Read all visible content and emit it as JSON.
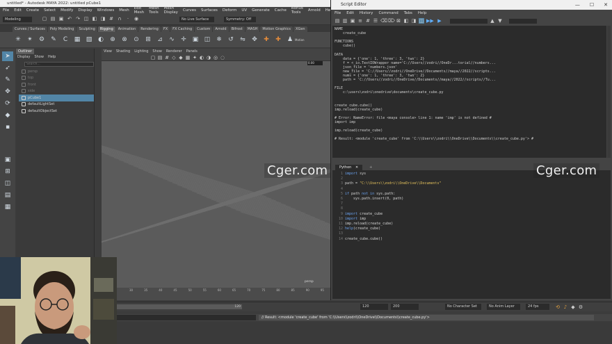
{
  "maya": {
    "title": "untitled* - Autodesk MAYA 2022: untitled    pCube1",
    "menus": [
      "File",
      "Edit",
      "Create",
      "Select",
      "Modify",
      "Display",
      "Windows",
      "Mesh",
      "Edit Mesh",
      "Mesh Tools",
      "Mesh Display",
      "Curves",
      "Surfaces",
      "Deform",
      "UV",
      "Generate",
      "Cache",
      "Bonus Tools",
      "Arnold",
      "Help"
    ],
    "workspace": "Modeling",
    "live_surface": "No Live Surface",
    "symmetry": "Symmetry: Off",
    "shelf_tabs": [
      "Curves / Surfaces",
      "Poly Modeling",
      "Sculpting",
      "Rigging",
      "Animation",
      "Rendering",
      "FX",
      "FX Caching",
      "Custom",
      "Arnold",
      "Bifrost",
      "MASH",
      "Motion Graphics",
      "XGen"
    ],
    "active_shelf": "Rigging",
    "shelf_label_motion": "Motion"
  },
  "outliner": {
    "tab": "Outliner",
    "menu": [
      "Display",
      "Show",
      "Help"
    ],
    "search_placeholder": "Search...",
    "items": [
      {
        "label": "persp",
        "selected": false,
        "visible": false
      },
      {
        "label": "top",
        "selected": false,
        "visible": false
      },
      {
        "label": "front",
        "selected": false,
        "visible": false
      },
      {
        "label": "side",
        "selected": false,
        "visible": false
      },
      {
        "label": "pCube1",
        "selected": true,
        "visible": true
      },
      {
        "label": "defaultLightSet",
        "selected": false,
        "visible": true
      },
      {
        "label": "defaultObjectSet",
        "selected": false,
        "visible": true
      }
    ]
  },
  "viewport": {
    "menus": [
      "View",
      "Shading",
      "Lighting",
      "Show",
      "Renderer",
      "Panels"
    ],
    "camera": "persp",
    "fps_value": "0.00"
  },
  "timeline": {
    "ticks": [
      "30",
      "35",
      "40",
      "45",
      "50",
      "55",
      "60",
      "65",
      "70",
      "75",
      "80",
      "85",
      "90",
      "95"
    ],
    "range_value": "120",
    "end_values": [
      "120",
      "200"
    ],
    "character_set": "No Character Set",
    "anim_layer": "No Anim Layer",
    "fps": "24 fps"
  },
  "command_line": {
    "result": "// Result: <module 'create_cube' from 'C:\\\\Users\\\\zodri\\\\OneDrive\\\\Documents\\\\create_cube.py'>"
  },
  "script_editor": {
    "title": "Script Editor",
    "menus": [
      "File",
      "Edit",
      "History",
      "Command",
      "Tabs",
      "Help"
    ],
    "history_lines": [
      "NAME",
      "    create_cube",
      "",
      "FUNCTIONS",
      "    cube()",
      "",
      "DATA",
      "    data = {'one': 1, 'three': 3, 'two': 2}",
      "    f = <_io.TextIOWrapper name='C://Users//zodri//OneDr...torial//numbers...",
      "    json_file = 'numbers.json'",
      "    new_file = 'C://Users//zodri//OneDrive//Documents//maya//2022//scripts...",
      "    nums = {'one': 1, 'three': 3, 'two': 2}",
      "    path = 'C://Users//zodri//OneDrive//Documents//maya//2022//scripts//Tu...",
      "",
      "FILE",
      "    c:\\users\\zodri\\onedrive\\documents\\create_cube.py",
      "",
      "",
      "create_cube.cube()",
      "imp.reload(create_cube)",
      "",
      "# Error: NameError: file <maya console> line 1: name 'imp' is not defined #",
      "import imp",
      "",
      "imp.reload(create_cube)",
      "",
      "# Result: <module 'create_cube' from 'C:\\\\Users\\\\zodri\\\\OneDrive\\\\Documents\\\\create_cube.py'> #"
    ],
    "tabs": [
      "Python"
    ],
    "add_tab": "+",
    "line_numbers": [
      "1",
      "2",
      "3",
      "4",
      "5",
      "6",
      "7",
      "8",
      "9",
      "10",
      "11",
      "12",
      "13",
      "14"
    ],
    "code": {
      "l1_kw": "import",
      "l1_rest": " sys",
      "l3_pre": "path = ",
      "l3_str": "\"C:\\\\Users\\\\zodri\\\\OneDrive\\\\Documents\"",
      "l5_kw1": "if",
      "l5_mid": " path ",
      "l5_kw2": "not in",
      "l5_rest": " sys.path:",
      "l6": "    sys.path.insert(0, path)",
      "l9_kw": "import",
      "l9_rest": " create_cube",
      "l10_kw": "import",
      "l10_rest": " imp",
      "l11": "imp.reload(create_cube)",
      "l12_kw": "help",
      "l12_rest": "(create_cube)",
      "l14": "create_cube.cube()"
    }
  },
  "watermark": "Cger.com",
  "colors": {
    "selection": "#5285a6",
    "editor_bg": "#2b2b2b",
    "keyword": "#6aa2f0",
    "string": "#e6c35c"
  }
}
